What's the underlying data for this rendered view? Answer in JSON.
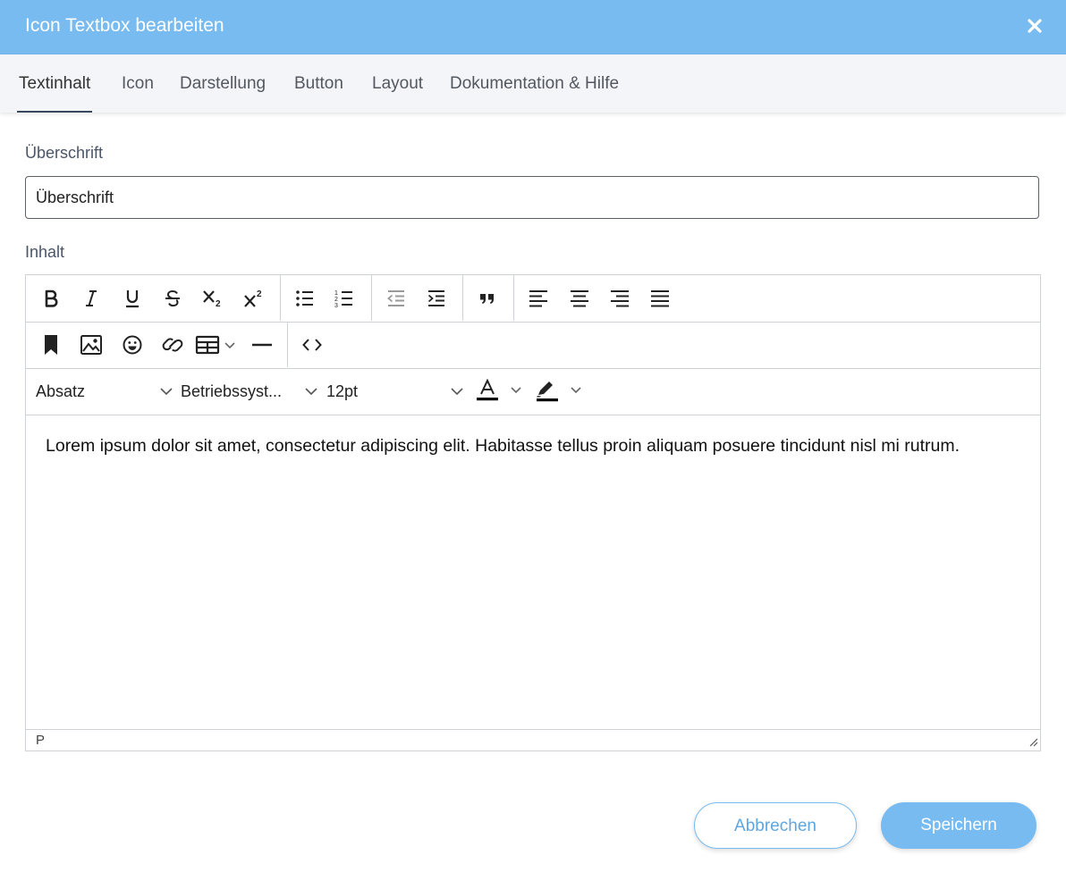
{
  "dialog": {
    "title": "Icon Textbox bearbeiten",
    "header_color": "#78bbf0"
  },
  "tabs": [
    {
      "label": "Textinhalt",
      "active": true
    },
    {
      "label": "Icon",
      "active": false
    },
    {
      "label": "Darstellung",
      "active": false
    },
    {
      "label": "Button",
      "active": false
    },
    {
      "label": "Layout",
      "active": false
    },
    {
      "label": "Dokumentation & Hilfe",
      "active": false
    }
  ],
  "heading_field": {
    "label": "Überschrift",
    "value": "Überschrift"
  },
  "content_field": {
    "label": "Inhalt"
  },
  "editor": {
    "toolbar_row1": [
      "bold-icon",
      "italic-icon",
      "underline-icon",
      "strikethrough-icon",
      "subscript-icon",
      "superscript-icon",
      "bullet-list-icon",
      "numbered-list-icon",
      "outdent-icon",
      "indent-icon",
      "blockquote-icon",
      "align-left-icon",
      "align-center-icon",
      "align-right-icon",
      "align-justify-icon"
    ],
    "toolbar_row2": [
      "bookmark-icon",
      "image-icon",
      "emoji-icon",
      "link-icon",
      "table-icon",
      "horizontal-rule-icon",
      "source-code-icon"
    ],
    "block_format": "Absatz",
    "font_family": "Betriebssyst...",
    "font_size": "12pt",
    "body_text": "Lorem ipsum dolor sit amet, consectetur adipiscing elit. Habitasse tellus proin aliquam posuere tincidunt nisl mi rutrum.",
    "status_path": "P"
  },
  "footer": {
    "cancel_label": "Abbrechen",
    "save_label": "Speichern",
    "accent_color": "#78bbf0"
  }
}
